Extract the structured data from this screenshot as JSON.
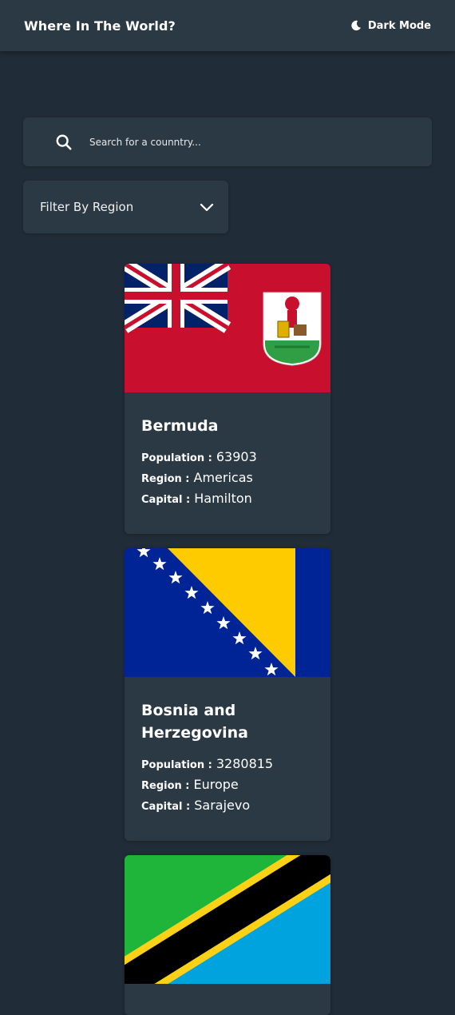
{
  "header": {
    "title": "Where In The World?",
    "theme_toggle_label": "Dark Mode"
  },
  "search": {
    "placeholder": "Search for a counntry..."
  },
  "filter": {
    "label": "Filter By Region"
  },
  "labels": {
    "population": "Population :",
    "region": "Region :",
    "capital": "Capital :"
  },
  "countries": [
    {
      "name": "Bermuda",
      "population": "63903",
      "region": "Americas",
      "capital": "Hamilton",
      "flag_icon": "bermuda-flag"
    },
    {
      "name": "Bosnia and Herzegovina",
      "population": "3280815",
      "region": "Europe",
      "capital": "Sarajevo",
      "flag_icon": "bosnia-flag"
    },
    {
      "flag_icon": "tanzania-flag"
    }
  ],
  "colors": {
    "background": "#202c37",
    "surface": "#2b3945",
    "text": "#ffffff"
  }
}
